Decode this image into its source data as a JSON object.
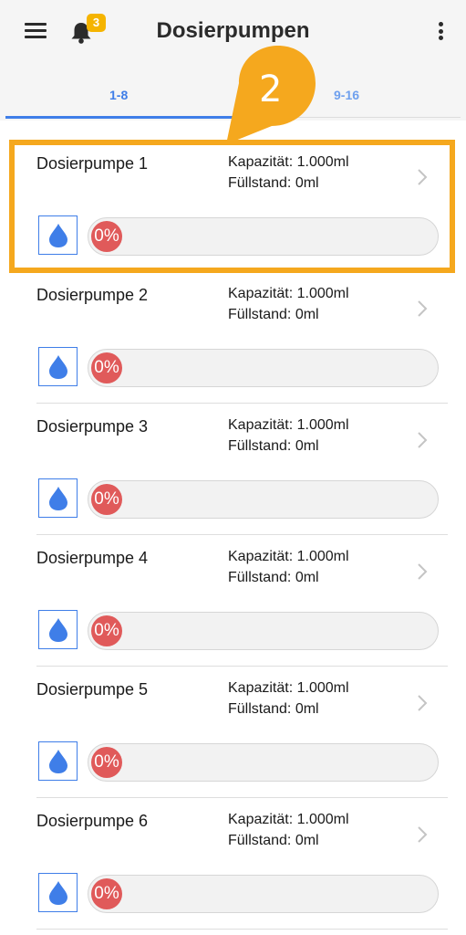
{
  "app_bar": {
    "title": "Dosierpumpen",
    "notification_count": "3"
  },
  "tabs": [
    {
      "label": "1-8",
      "active": true
    },
    {
      "label": "9-16",
      "active": false
    }
  ],
  "tutorial": {
    "step_number": "2"
  },
  "pumps": [
    {
      "name": "Dosierpumpe 1",
      "capacity": "Kapazität: 1.000ml",
      "fill_level": "Füllstand: 0ml",
      "percent": "0%",
      "fill_fraction": 0
    },
    {
      "name": "Dosierpumpe 2",
      "capacity": "Kapazität: 1.000ml",
      "fill_level": "Füllstand: 0ml",
      "percent": "0%",
      "fill_fraction": 0
    },
    {
      "name": "Dosierpumpe 3",
      "capacity": "Kapazität: 1.000ml",
      "fill_level": "Füllstand: 0ml",
      "percent": "0%",
      "fill_fraction": 0
    },
    {
      "name": "Dosierpumpe 4",
      "capacity": "Kapazität: 1.000ml",
      "fill_level": "Füllstand: 0ml",
      "percent": "0%",
      "fill_fraction": 0
    },
    {
      "name": "Dosierpumpe 5",
      "capacity": "Kapazität: 1.000ml",
      "fill_level": "Füllstand: 0ml",
      "percent": "0%",
      "fill_fraction": 0
    },
    {
      "name": "Dosierpumpe 6",
      "capacity": "Kapazität: 1.000ml",
      "fill_level": "Füllstand: 0ml",
      "percent": "0%",
      "fill_fraction": 0
    }
  ],
  "icons": {
    "menu": "hamburger-icon",
    "notifications": "bell-icon",
    "more": "more-vertical-icon",
    "row_action": "chevron-right-icon",
    "pump_symbol": "water-drop-icon"
  },
  "colors": {
    "accent": "#3f7ee8",
    "highlight": "#f5a81e",
    "badge": "#f5b400",
    "level_empty": "#e05a5a"
  }
}
